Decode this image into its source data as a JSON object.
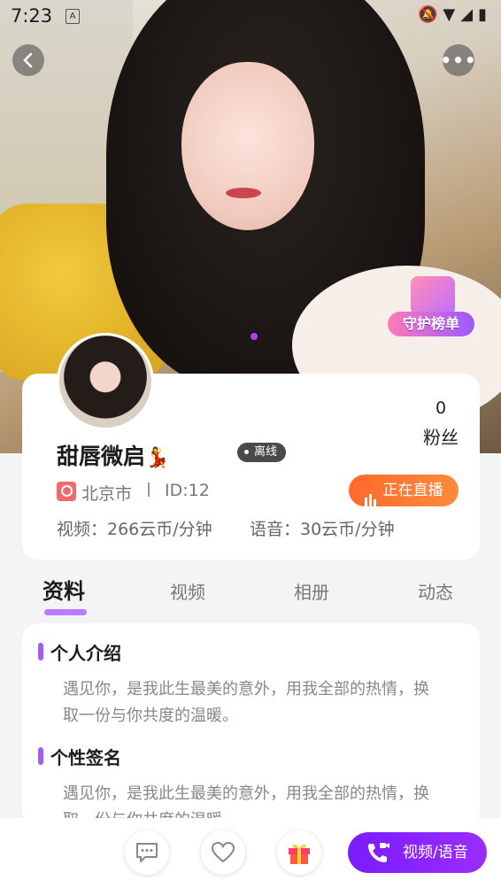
{
  "status_bar": {
    "time": "7:23",
    "a_indicator": "A"
  },
  "profile": {
    "fans_count": "0",
    "fans_label": "粉丝",
    "name": "甜唇微启",
    "name_emoji": "💃",
    "online_status": "离线",
    "city": "北京市",
    "id_text": "ID:12",
    "live_button": "正在直播",
    "video_price": "视频：266云币/分钟",
    "voice_price": "语音：30云币/分钟"
  },
  "hero": {
    "guard_badge": "守护榜单"
  },
  "tabs": [
    "资料",
    "视频",
    "相册",
    "动态"
  ],
  "sections": [
    {
      "title": "个人介绍",
      "text": "遇见你，是我此生最美的意外，用我全部的热情，换取一份与你共度的温暖。"
    },
    {
      "title": "个性签名",
      "text": "遇见你，是我此生最美的意外，用我全部的热情，换取一份与你共度的温暖。"
    }
  ],
  "bottom_bar": {
    "call_label": "视频/语音"
  },
  "colors": {
    "accent_purple": "#8a24ff",
    "live_orange": "#ff6a2b",
    "offline_gray": "#4a4a4a"
  }
}
